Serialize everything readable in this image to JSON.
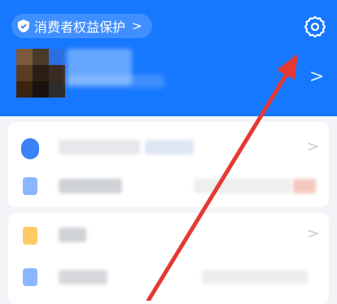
{
  "header": {
    "consumer_protection_label": "消费者权益保护",
    "consumer_protection_chevron": ">",
    "profile_chevron": ">"
  },
  "colors": {
    "primary_blue": "#1677ff",
    "page_background": "#f2f4f7",
    "annotation_arrow": "#e53935"
  },
  "icons": {
    "settings": "gear-icon",
    "consumer": "shield-icon"
  },
  "list_chevron": ">"
}
